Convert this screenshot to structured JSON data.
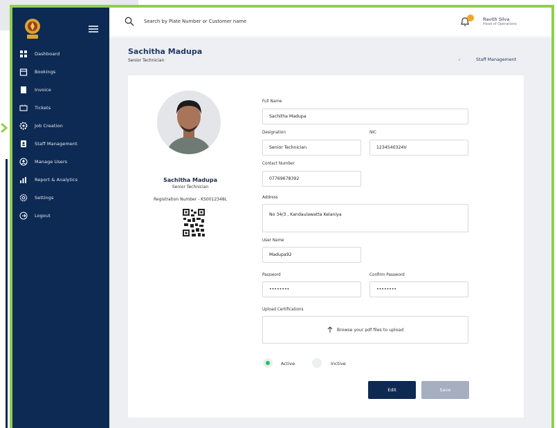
{
  "sidebar": {
    "items": [
      {
        "label": "Dashboard",
        "icon": "dashboard-icon"
      },
      {
        "label": "Bookings",
        "icon": "calendar-icon"
      },
      {
        "label": "Invoice",
        "icon": "invoice-icon"
      },
      {
        "label": "Tickets",
        "icon": "ticket-icon"
      },
      {
        "label": "Job Creation",
        "icon": "gear-icon"
      },
      {
        "label": "Staff Management",
        "icon": "staff-icon"
      },
      {
        "label": "Manage Users",
        "icon": "user-circle-icon"
      },
      {
        "label": "Report & Analytics",
        "icon": "bar-chart-icon"
      },
      {
        "label": "Settings",
        "icon": "settings-icon"
      },
      {
        "label": "Logout",
        "icon": "logout-icon"
      }
    ]
  },
  "topbar": {
    "search_placeholder": "Search by Plate Number or Customer name",
    "user_name": "Ravith Silva",
    "user_role": "Head of Operations"
  },
  "page": {
    "title": "Sachitha Madupa",
    "subtitle": "Senior Technician",
    "breadcrumb": "Staff Management"
  },
  "profile": {
    "name": "Sachitha Madupa",
    "role": "Senior Technician",
    "registration": "Registration Number - KS0012348L"
  },
  "form": {
    "full_name_label": "Full Name",
    "full_name": "Sachitha Madupa",
    "designation_label": "Designation",
    "designation": "Senior Technician",
    "nic_label": "NIC",
    "nic": "1234540324V",
    "contact_label": "Contact Number",
    "contact": "07769678392",
    "address_label": "Address",
    "address": "No 34/3 , Kandaulawatta Kelaniya",
    "username_label": "User Name",
    "username": "Madupa92",
    "password_label": "Password",
    "password": "••••••••",
    "confirm_password_label": "Confirm Password",
    "confirm_password": "••••••••",
    "upload_label": "Upload Certifications",
    "upload_text": "Browse your pdf files to upload"
  },
  "status": {
    "active_label": "Active",
    "inactive_label": "Inctive",
    "selected": "Active"
  },
  "buttons": {
    "edit": "Edit",
    "save": "Save"
  },
  "colors": {
    "sidebar": "#0c2a53",
    "accent_green": "#21c063",
    "frame_green": "#8fce4d",
    "edit_button": "#0e2a52",
    "save_button": "#a5afc0"
  }
}
